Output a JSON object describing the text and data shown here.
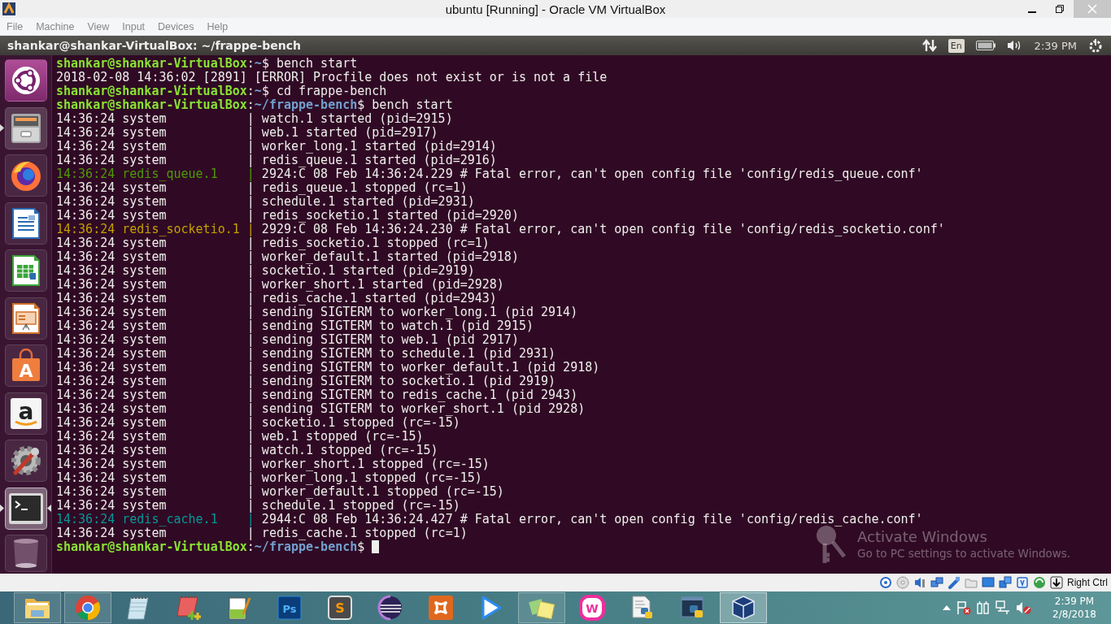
{
  "window": {
    "title": "ubuntu [Running] - Oracle VM VirtualBox"
  },
  "menu": [
    "File",
    "Machine",
    "View",
    "Input",
    "Devices",
    "Help"
  ],
  "panel": {
    "title": "shankar@shankar-VirtualBox: ~/frappe-bench",
    "keyboard": "En",
    "clock": "2:39 PM"
  },
  "launcher": [
    {
      "kind": "dash",
      "running": false,
      "focused": false
    },
    {
      "kind": "files",
      "running": true,
      "focused": false
    },
    {
      "kind": "firefox",
      "running": false,
      "focused": false
    },
    {
      "kind": "writer",
      "running": false,
      "focused": false
    },
    {
      "kind": "calc",
      "running": false,
      "focused": false
    },
    {
      "kind": "impress",
      "running": false,
      "focused": false
    },
    {
      "kind": "store",
      "glyph": "A",
      "running": false,
      "focused": false
    },
    {
      "kind": "amazon",
      "glyph": "a",
      "running": false,
      "focused": false
    },
    {
      "kind": "settings",
      "running": false,
      "focused": false
    },
    {
      "kind": "terminal",
      "running": true,
      "focused": true
    },
    {
      "kind": "trash",
      "running": false,
      "focused": false
    }
  ],
  "terminal": {
    "lines": [
      {
        "kind": "prompt",
        "user": "shankar@shankar-VirtualBox",
        "separator": ":",
        "path": "~",
        "command": "$ bench start"
      },
      {
        "kind": "output",
        "text": "2018-02-08 14:36:02 [2891] [ERROR] Procfile does not exist or is not a file"
      },
      {
        "kind": "prompt",
        "user": "shankar@shankar-VirtualBox",
        "separator": ":",
        "path": "~",
        "command": "$ cd frappe-bench"
      },
      {
        "kind": "prompt",
        "user": "shankar@shankar-VirtualBox",
        "separator": ":",
        "path": "~/frappe-bench",
        "command": "$ bench start"
      },
      {
        "kind": "log",
        "prefix": "14:36:24 system           |",
        "message": "watch.1 started (pid=2915)",
        "color": "#eeeeec"
      },
      {
        "kind": "log",
        "prefix": "14:36:24 system           |",
        "message": "web.1 started (pid=2917)",
        "color": "#eeeeec"
      },
      {
        "kind": "log",
        "prefix": "14:36:24 system           |",
        "message": "worker_long.1 started (pid=2914)",
        "color": "#eeeeec"
      },
      {
        "kind": "log",
        "prefix": "14:36:24 system           |",
        "message": "redis_queue.1 started (pid=2916)",
        "color": "#eeeeec"
      },
      {
        "kind": "log",
        "prefix": "14:36:24 redis_queue.1    |",
        "message": "2924:C 08 Feb 14:36:24.229 # Fatal error, can't open config file 'config/redis_queue.conf'",
        "color": "#4e9a06"
      },
      {
        "kind": "log",
        "prefix": "14:36:24 system           |",
        "message": "redis_queue.1 stopped (rc=1)",
        "color": "#eeeeec"
      },
      {
        "kind": "log",
        "prefix": "14:36:24 system           |",
        "message": "schedule.1 started (pid=2931)",
        "color": "#eeeeec"
      },
      {
        "kind": "log",
        "prefix": "14:36:24 system           |",
        "message": "redis_socketio.1 started (pid=2920)",
        "color": "#eeeeec"
      },
      {
        "kind": "log",
        "prefix": "14:36:24 redis_socketio.1 |",
        "message": "2929:C 08 Feb 14:36:24.230 # Fatal error, can't open config file 'config/redis_socketio.conf'",
        "color": "#c4a000"
      },
      {
        "kind": "log",
        "prefix": "14:36:24 system           |",
        "message": "redis_socketio.1 stopped (rc=1)",
        "color": "#eeeeec"
      },
      {
        "kind": "log",
        "prefix": "14:36:24 system           |",
        "message": "worker_default.1 started (pid=2918)",
        "color": "#eeeeec"
      },
      {
        "kind": "log",
        "prefix": "14:36:24 system           |",
        "message": "socketio.1 started (pid=2919)",
        "color": "#eeeeec"
      },
      {
        "kind": "log",
        "prefix": "14:36:24 system           |",
        "message": "worker_short.1 started (pid=2928)",
        "color": "#eeeeec"
      },
      {
        "kind": "log",
        "prefix": "14:36:24 system           |",
        "message": "redis_cache.1 started (pid=2943)",
        "color": "#eeeeec"
      },
      {
        "kind": "log",
        "prefix": "14:36:24 system           |",
        "message": "sending SIGTERM to worker_long.1 (pid 2914)",
        "color": "#eeeeec"
      },
      {
        "kind": "log",
        "prefix": "14:36:24 system           |",
        "message": "sending SIGTERM to watch.1 (pid 2915)",
        "color": "#eeeeec"
      },
      {
        "kind": "log",
        "prefix": "14:36:24 system           |",
        "message": "sending SIGTERM to web.1 (pid 2917)",
        "color": "#eeeeec"
      },
      {
        "kind": "log",
        "prefix": "14:36:24 system           |",
        "message": "sending SIGTERM to schedule.1 (pid 2931)",
        "color": "#eeeeec"
      },
      {
        "kind": "log",
        "prefix": "14:36:24 system           |",
        "message": "sending SIGTERM to worker_default.1 (pid 2918)",
        "color": "#eeeeec"
      },
      {
        "kind": "log",
        "prefix": "14:36:24 system           |",
        "message": "sending SIGTERM to socketio.1 (pid 2919)",
        "color": "#eeeeec"
      },
      {
        "kind": "log",
        "prefix": "14:36:24 system           |",
        "message": "sending SIGTERM to redis_cache.1 (pid 2943)",
        "color": "#eeeeec"
      },
      {
        "kind": "log",
        "prefix": "14:36:24 system           |",
        "message": "sending SIGTERM to worker_short.1 (pid 2928)",
        "color": "#eeeeec"
      },
      {
        "kind": "log",
        "prefix": "14:36:24 system           |",
        "message": "socketio.1 stopped (rc=-15)",
        "color": "#eeeeec"
      },
      {
        "kind": "log",
        "prefix": "14:36:24 system           |",
        "message": "web.1 stopped (rc=-15)",
        "color": "#eeeeec"
      },
      {
        "kind": "log",
        "prefix": "14:36:24 system           |",
        "message": "watch.1 stopped (rc=-15)",
        "color": "#eeeeec"
      },
      {
        "kind": "log",
        "prefix": "14:36:24 system           |",
        "message": "worker_short.1 stopped (rc=-15)",
        "color": "#eeeeec"
      },
      {
        "kind": "log",
        "prefix": "14:36:24 system           |",
        "message": "worker_long.1 stopped (rc=-15)",
        "color": "#eeeeec"
      },
      {
        "kind": "log",
        "prefix": "14:36:24 system           |",
        "message": "worker_default.1 stopped (rc=-15)",
        "color": "#eeeeec"
      },
      {
        "kind": "log",
        "prefix": "14:36:24 system           |",
        "message": "schedule.1 stopped (rc=-15)",
        "color": "#eeeeec"
      },
      {
        "kind": "log",
        "prefix": "14:36:24 redis_cache.1    |",
        "message": "2944:C 08 Feb 14:36:24.427 # Fatal error, can't open config file 'config/redis_cache.conf'",
        "color": "#06989a"
      },
      {
        "kind": "log",
        "prefix": "14:36:24 system           |",
        "message": "redis_cache.1 stopped (rc=1)",
        "color": "#eeeeec"
      },
      {
        "kind": "prompt",
        "user": "shankar@shankar-VirtualBox",
        "separator": ":",
        "path": "~/frappe-bench",
        "command": "$",
        "cursor": true
      }
    ]
  },
  "activation": {
    "title": "Activate Windows",
    "message": "Go to PC settings to activate Windows."
  },
  "vm_status": {
    "host_key": "Right Ctrl"
  },
  "taskbar": {
    "apps": [
      {
        "kind": "folder",
        "running": true,
        "active": false
      },
      {
        "kind": "chrome",
        "running": true,
        "active": false
      },
      {
        "kind": "notepad",
        "running": false,
        "active": false
      },
      {
        "kind": "notepad_plus",
        "running": false,
        "active": false
      },
      {
        "kind": "notepadpp",
        "running": false,
        "active": false
      },
      {
        "kind": "ps",
        "glyph": "Ps",
        "running": false,
        "active": false
      },
      {
        "kind": "sublime",
        "glyph": "S",
        "running": false,
        "active": false
      },
      {
        "kind": "eclipse",
        "running": false,
        "active": false
      },
      {
        "kind": "xampp",
        "running": false,
        "active": false
      },
      {
        "kind": "play",
        "running": false,
        "active": false
      },
      {
        "kind": "sticky",
        "running": true,
        "active": false
      },
      {
        "kind": "wamp",
        "glyph": "W",
        "running": false,
        "active": false
      },
      {
        "kind": "pyfile",
        "running": false,
        "active": false
      },
      {
        "kind": "idle",
        "running": false,
        "active": false
      },
      {
        "kind": "vbox",
        "running": true,
        "active": true
      }
    ],
    "clock": "2:39 PM",
    "date": "2/8/2018"
  }
}
